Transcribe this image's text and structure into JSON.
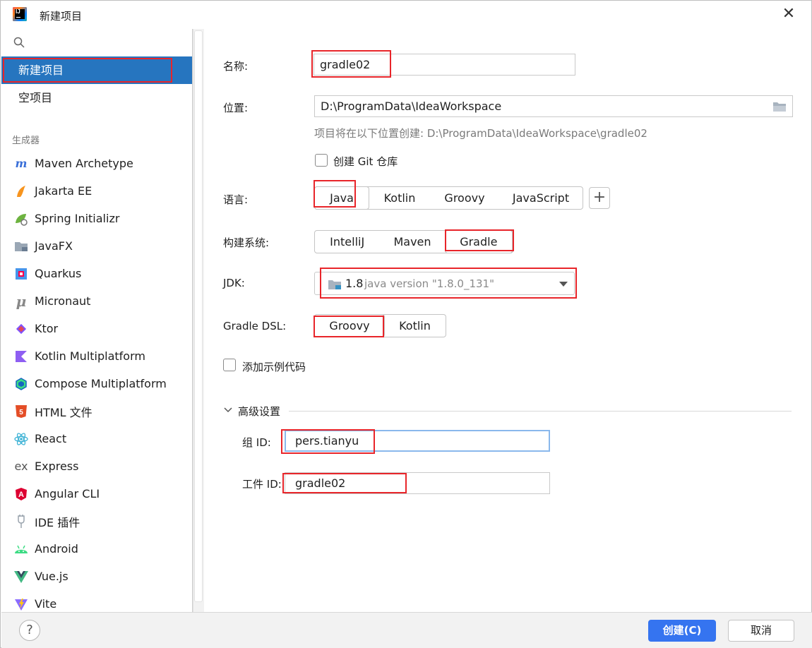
{
  "window": {
    "title": "新建项目",
    "close_label": "✕"
  },
  "sidebar": {
    "search_placeholder": "",
    "items": [
      {
        "label": "新建项目",
        "selected": true
      },
      {
        "label": "空项目",
        "selected": false
      }
    ],
    "generators_title": "生成器",
    "generators": [
      {
        "label": "Maven Archetype",
        "icon": "maven-icon"
      },
      {
        "label": "Jakarta EE",
        "icon": "jakarta-icon"
      },
      {
        "label": "Spring Initializr",
        "icon": "spring-icon"
      },
      {
        "label": "JavaFX",
        "icon": "javafx-icon"
      },
      {
        "label": "Quarkus",
        "icon": "quarkus-icon"
      },
      {
        "label": "Micronaut",
        "icon": "micronaut-icon"
      },
      {
        "label": "Ktor",
        "icon": "ktor-icon"
      },
      {
        "label": "Kotlin Multiplatform",
        "icon": "kotlin-icon"
      },
      {
        "label": "Compose Multiplatform",
        "icon": "compose-icon"
      },
      {
        "label": "HTML 文件",
        "icon": "html5-icon"
      },
      {
        "label": "React",
        "icon": "react-icon"
      },
      {
        "label": "Express",
        "icon": "express-icon"
      },
      {
        "label": "Angular CLI",
        "icon": "angular-icon"
      },
      {
        "label": "IDE 插件",
        "icon": "ide-plugin-icon"
      },
      {
        "label": "Android",
        "icon": "android-icon"
      },
      {
        "label": "Vue.js",
        "icon": "vue-icon"
      },
      {
        "label": "Vite",
        "icon": "vite-icon"
      }
    ]
  },
  "form": {
    "name_label": "名称:",
    "name_value": "gradle02",
    "location_label": "位置:",
    "location_value": "D:\\ProgramData\\IdeaWorkspace",
    "location_hint": "项目将在以下位置创建: D:\\ProgramData\\IdeaWorkspace\\gradle02",
    "git_label": "创建 Git 仓库",
    "language_label": "语言:",
    "languages": [
      "Java",
      "Kotlin",
      "Groovy",
      "JavaScript"
    ],
    "language_selected": "Java",
    "add_language_label": "+",
    "build_label": "构建系统:",
    "build_systems": [
      "IntelliJ",
      "Maven",
      "Gradle"
    ],
    "build_selected": "Gradle",
    "jdk_label": "JDK:",
    "jdk_version": "1.8",
    "jdk_detail": "java version \"1.8.0_131\"",
    "dsl_label": "Gradle DSL:",
    "dsl_options": [
      "Groovy",
      "Kotlin"
    ],
    "dsl_selected": "Groovy",
    "sample_label": "添加示例代码",
    "advanced_label": "高级设置",
    "group_label": "组 ID:",
    "group_value": "pers.tianyu",
    "artifact_label": "工件 ID:",
    "artifact_value": "gradle02"
  },
  "footer": {
    "help_label": "?",
    "create_label": "创建(C)",
    "cancel_label": "取消"
  },
  "colors": {
    "selection": "#2675bf",
    "primary_button": "#3574f0",
    "highlight_box": "#e8252a"
  }
}
